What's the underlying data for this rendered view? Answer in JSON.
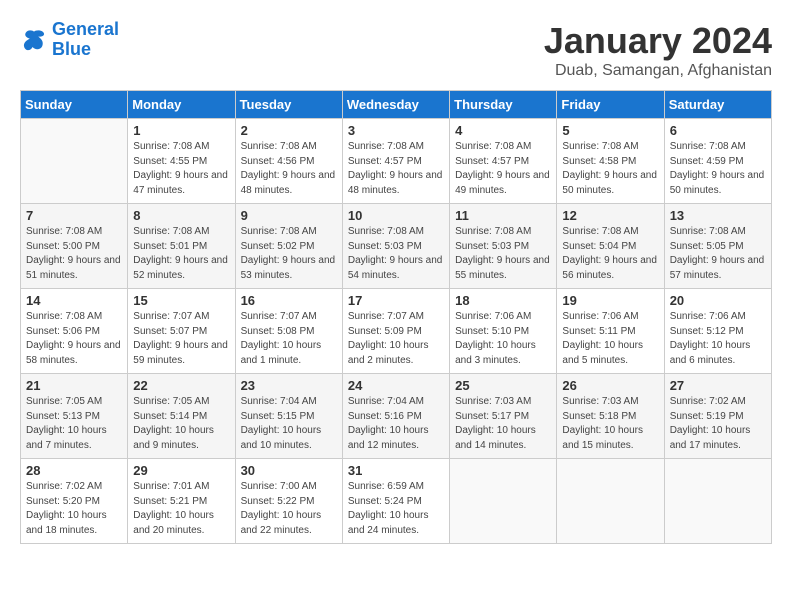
{
  "header": {
    "logo_line1": "General",
    "logo_line2": "Blue",
    "month_title": "January 2024",
    "subtitle": "Duab, Samangan, Afghanistan"
  },
  "weekdays": [
    "Sunday",
    "Monday",
    "Tuesday",
    "Wednesday",
    "Thursday",
    "Friday",
    "Saturday"
  ],
  "weeks": [
    [
      {
        "day": "",
        "empty": true
      },
      {
        "day": "1",
        "sunrise": "7:08 AM",
        "sunset": "4:55 PM",
        "daylight": "9 hours and 47 minutes."
      },
      {
        "day": "2",
        "sunrise": "7:08 AM",
        "sunset": "4:56 PM",
        "daylight": "9 hours and 48 minutes."
      },
      {
        "day": "3",
        "sunrise": "7:08 AM",
        "sunset": "4:57 PM",
        "daylight": "9 hours and 48 minutes."
      },
      {
        "day": "4",
        "sunrise": "7:08 AM",
        "sunset": "4:57 PM",
        "daylight": "9 hours and 49 minutes."
      },
      {
        "day": "5",
        "sunrise": "7:08 AM",
        "sunset": "4:58 PM",
        "daylight": "9 hours and 50 minutes."
      },
      {
        "day": "6",
        "sunrise": "7:08 AM",
        "sunset": "4:59 PM",
        "daylight": "9 hours and 50 minutes."
      }
    ],
    [
      {
        "day": "7",
        "sunrise": "7:08 AM",
        "sunset": "5:00 PM",
        "daylight": "9 hours and 51 minutes."
      },
      {
        "day": "8",
        "sunrise": "7:08 AM",
        "sunset": "5:01 PM",
        "daylight": "9 hours and 52 minutes."
      },
      {
        "day": "9",
        "sunrise": "7:08 AM",
        "sunset": "5:02 PM",
        "daylight": "9 hours and 53 minutes."
      },
      {
        "day": "10",
        "sunrise": "7:08 AM",
        "sunset": "5:03 PM",
        "daylight": "9 hours and 54 minutes."
      },
      {
        "day": "11",
        "sunrise": "7:08 AM",
        "sunset": "5:03 PM",
        "daylight": "9 hours and 55 minutes."
      },
      {
        "day": "12",
        "sunrise": "7:08 AM",
        "sunset": "5:04 PM",
        "daylight": "9 hours and 56 minutes."
      },
      {
        "day": "13",
        "sunrise": "7:08 AM",
        "sunset": "5:05 PM",
        "daylight": "9 hours and 57 minutes."
      }
    ],
    [
      {
        "day": "14",
        "sunrise": "7:08 AM",
        "sunset": "5:06 PM",
        "daylight": "9 hours and 58 minutes."
      },
      {
        "day": "15",
        "sunrise": "7:07 AM",
        "sunset": "5:07 PM",
        "daylight": "9 hours and 59 minutes."
      },
      {
        "day": "16",
        "sunrise": "7:07 AM",
        "sunset": "5:08 PM",
        "daylight": "10 hours and 1 minute."
      },
      {
        "day": "17",
        "sunrise": "7:07 AM",
        "sunset": "5:09 PM",
        "daylight": "10 hours and 2 minutes."
      },
      {
        "day": "18",
        "sunrise": "7:06 AM",
        "sunset": "5:10 PM",
        "daylight": "10 hours and 3 minutes."
      },
      {
        "day": "19",
        "sunrise": "7:06 AM",
        "sunset": "5:11 PM",
        "daylight": "10 hours and 5 minutes."
      },
      {
        "day": "20",
        "sunrise": "7:06 AM",
        "sunset": "5:12 PM",
        "daylight": "10 hours and 6 minutes."
      }
    ],
    [
      {
        "day": "21",
        "sunrise": "7:05 AM",
        "sunset": "5:13 PM",
        "daylight": "10 hours and 7 minutes."
      },
      {
        "day": "22",
        "sunrise": "7:05 AM",
        "sunset": "5:14 PM",
        "daylight": "10 hours and 9 minutes."
      },
      {
        "day": "23",
        "sunrise": "7:04 AM",
        "sunset": "5:15 PM",
        "daylight": "10 hours and 10 minutes."
      },
      {
        "day": "24",
        "sunrise": "7:04 AM",
        "sunset": "5:16 PM",
        "daylight": "10 hours and 12 minutes."
      },
      {
        "day": "25",
        "sunrise": "7:03 AM",
        "sunset": "5:17 PM",
        "daylight": "10 hours and 14 minutes."
      },
      {
        "day": "26",
        "sunrise": "7:03 AM",
        "sunset": "5:18 PM",
        "daylight": "10 hours and 15 minutes."
      },
      {
        "day": "27",
        "sunrise": "7:02 AM",
        "sunset": "5:19 PM",
        "daylight": "10 hours and 17 minutes."
      }
    ],
    [
      {
        "day": "28",
        "sunrise": "7:02 AM",
        "sunset": "5:20 PM",
        "daylight": "10 hours and 18 minutes."
      },
      {
        "day": "29",
        "sunrise": "7:01 AM",
        "sunset": "5:21 PM",
        "daylight": "10 hours and 20 minutes."
      },
      {
        "day": "30",
        "sunrise": "7:00 AM",
        "sunset": "5:22 PM",
        "daylight": "10 hours and 22 minutes."
      },
      {
        "day": "31",
        "sunrise": "6:59 AM",
        "sunset": "5:24 PM",
        "daylight": "10 hours and 24 minutes."
      },
      {
        "day": "",
        "empty": true
      },
      {
        "day": "",
        "empty": true
      },
      {
        "day": "",
        "empty": true
      }
    ]
  ]
}
